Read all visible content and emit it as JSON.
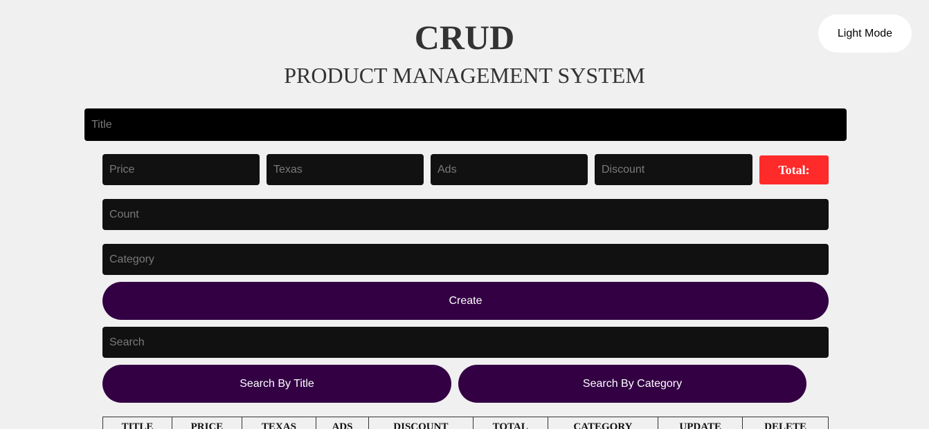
{
  "header": {
    "title": "CRUD",
    "subtitle": "PRODUCT MANAGEMENT SYSTEM",
    "mode_button_label": "Light Mode"
  },
  "form": {
    "title_placeholder": "Title",
    "price_placeholder": "Price",
    "texas_placeholder": "Texas",
    "ads_placeholder": "Ads",
    "discount_placeholder": "Discount",
    "total_label": "Total:",
    "count_placeholder": "Count",
    "category_placeholder": "Category",
    "create_label": "Create"
  },
  "search": {
    "placeholder": "Search",
    "by_title_label": "Search By Title",
    "by_category_label": "Search By Category"
  },
  "table": {
    "headers": [
      "TITLE",
      "PRICE",
      "TEXAS",
      "ADS",
      "DISCOUNT",
      "TOTAL",
      "CATEGORY",
      "UPDATE",
      "DELETE"
    ]
  },
  "colors": {
    "background": "#f0f0f0",
    "input_bg": "#111111",
    "total_badge": "#ff2a2a",
    "button_purple": "#330044"
  }
}
